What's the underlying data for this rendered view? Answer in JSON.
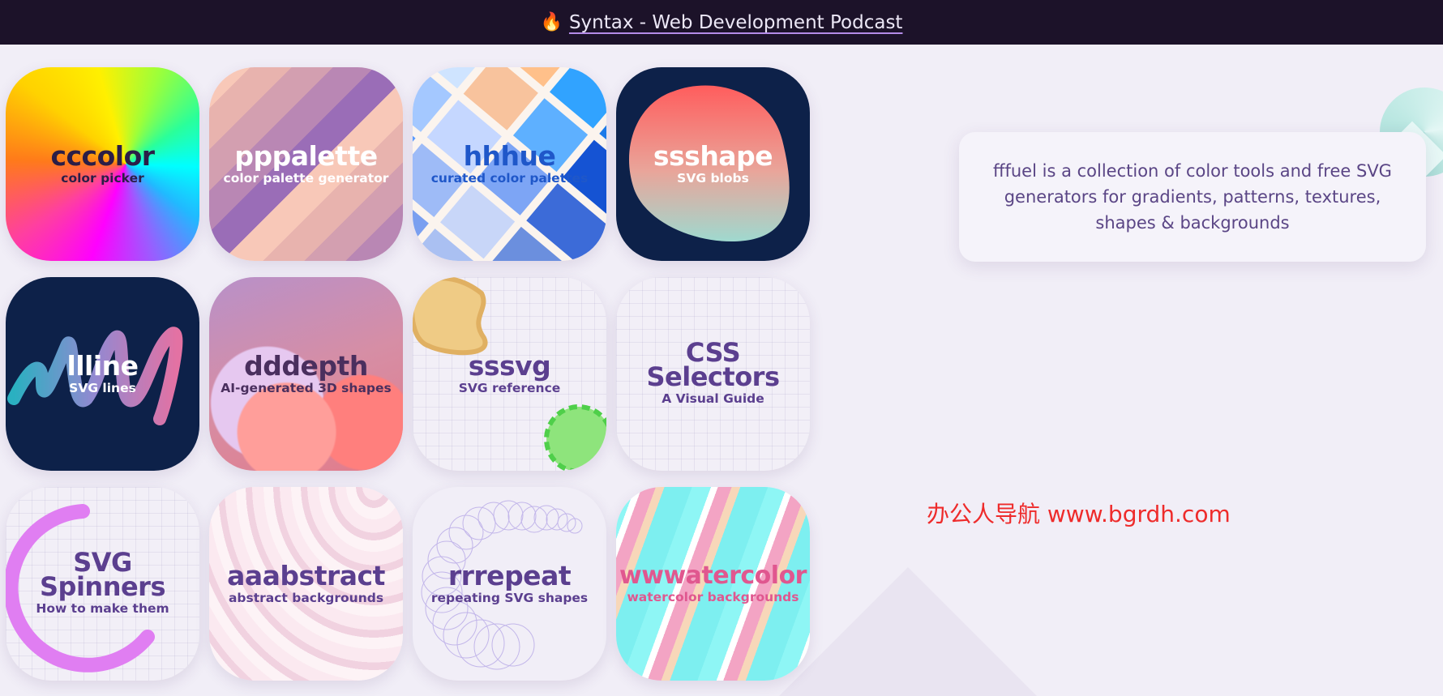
{
  "header": {
    "icon": "flame-icon",
    "link_text": "Syntax - Web Development Podcast"
  },
  "tiles": [
    {
      "title": "cccolor",
      "subtitle": "color picker",
      "title_color": "#2b1e47",
      "subtitle_color": "#2b1e47"
    },
    {
      "title": "pppalette",
      "subtitle": "color palette generator",
      "title_color": "#ffffff",
      "subtitle_color": "#ffffff"
    },
    {
      "title": "hhhue",
      "subtitle": "curated color palettes",
      "title_color": "#1f57c9",
      "subtitle_color": "#1f57c9"
    },
    {
      "title": "ssshape",
      "subtitle": "SVG blobs",
      "title_color": "#ffffff",
      "subtitle_color": "#ffffff"
    },
    {
      "title": "llline",
      "subtitle": "SVG lines",
      "title_color": "#ffffff",
      "subtitle_color": "#ffffff"
    },
    {
      "title": "dddepth",
      "subtitle": "AI-generated 3D shapes",
      "title_color": "#4a2f5e",
      "subtitle_color": "#4a2f5e"
    },
    {
      "title": "sssvg",
      "subtitle": "SVG reference",
      "title_color": "#5b3f8f",
      "subtitle_color": "#5b3f8f"
    },
    {
      "title_line1": "CSS",
      "title_line2": "Selectors",
      "subtitle": "A Visual Guide",
      "title_color": "#5b3f8f",
      "subtitle_color": "#5b3f8f"
    },
    {
      "title_line1": "SVG",
      "title_line2": "Spinners",
      "subtitle": "How to make them",
      "title_color": "#5b3f8f",
      "subtitle_color": "#5b3f8f"
    },
    {
      "title": "aaabstract",
      "subtitle": "abstract backgrounds",
      "title_color": "#5b3f8f",
      "subtitle_color": "#5b3f8f"
    },
    {
      "title": "rrrepeat",
      "subtitle": "repeating SVG shapes",
      "title_color": "#5b3f8f",
      "subtitle_color": "#5b3f8f"
    },
    {
      "title": "wwwatercolor",
      "subtitle": "watercolor backgrounds",
      "title_color": "#e0578f",
      "subtitle_color": "#e0578f"
    }
  ],
  "info": {
    "text": "fffuel is a collection of color tools and free SVG generators for gradients, patterns, textures, shapes & backgrounds"
  },
  "watermark": {
    "text": "办公人导航 www.bgrdh.com"
  },
  "colors": {
    "topbar_bg": "#1c1229",
    "page_bg": "#f1eef7",
    "accent_purple": "#5b3f8f"
  }
}
